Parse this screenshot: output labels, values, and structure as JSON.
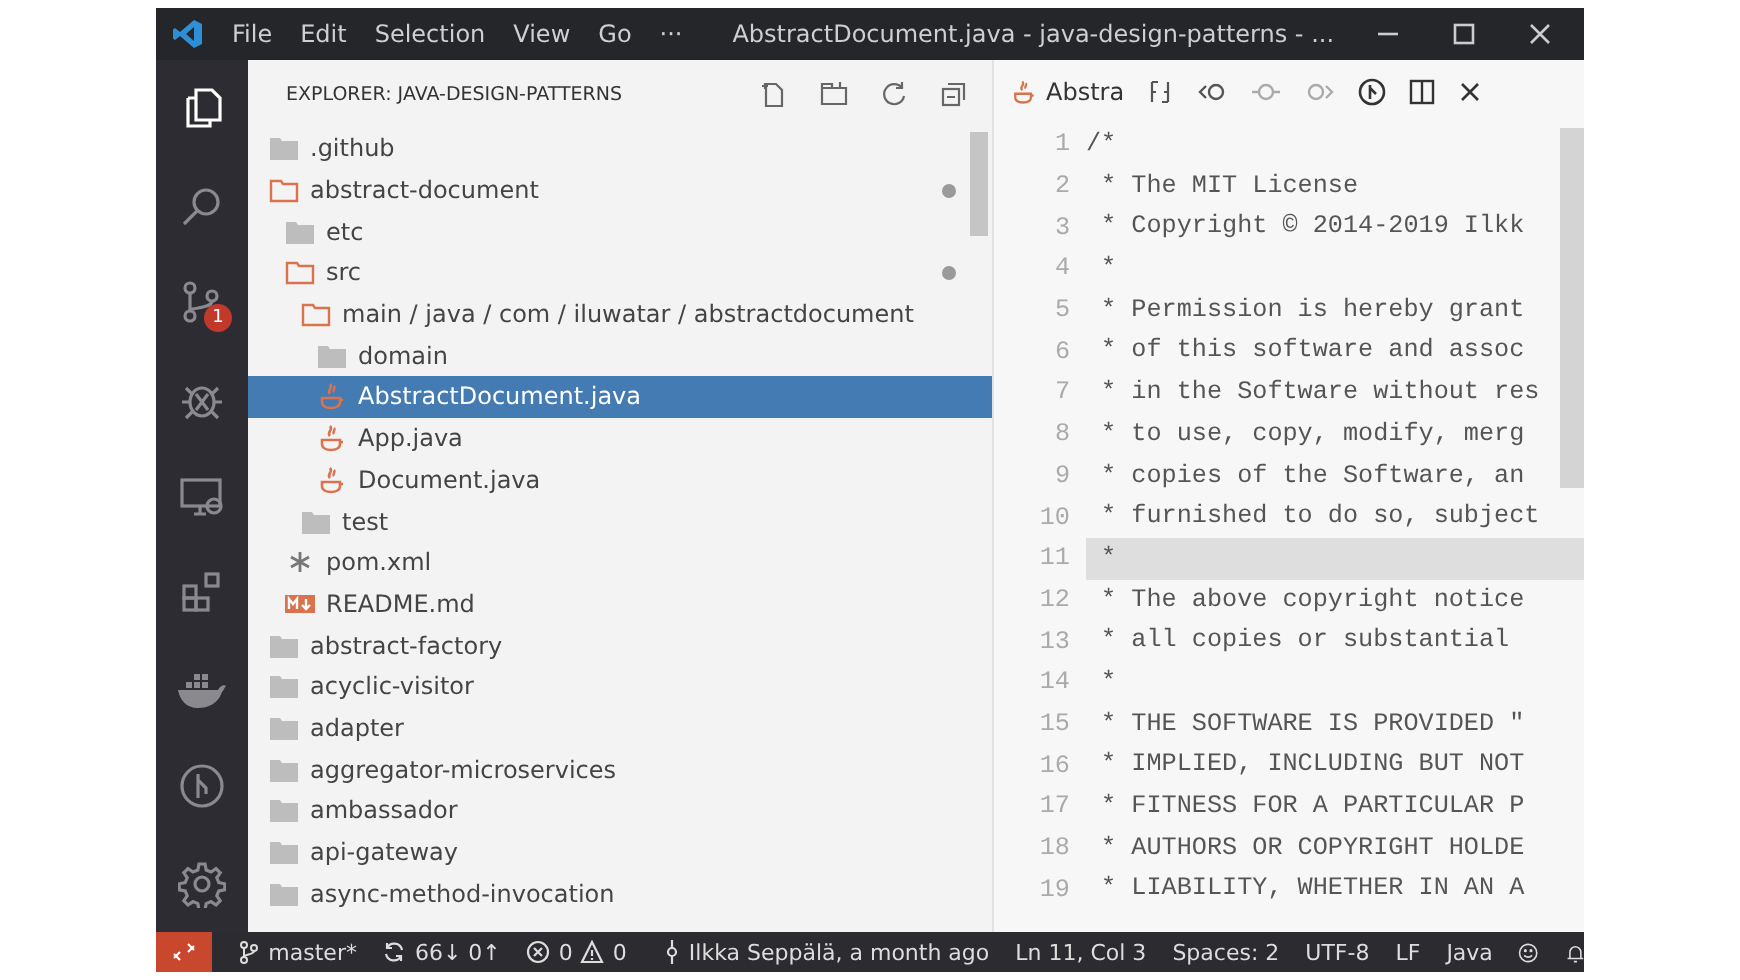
{
  "window": {
    "title": "AbstractDocument.java - java-design-patterns - ..."
  },
  "menu": [
    "File",
    "Edit",
    "Selection",
    "View",
    "Go",
    "···"
  ],
  "activity_bar": [
    {
      "kind": "files",
      "selected": true
    },
    {
      "kind": "search",
      "selected": false
    },
    {
      "kind": "source-control",
      "selected": false,
      "badge": "1"
    },
    {
      "kind": "debug",
      "selected": false
    },
    {
      "kind": "remote",
      "selected": false
    },
    {
      "kind": "extensions",
      "selected": false
    },
    {
      "kind": "docker",
      "selected": false
    },
    {
      "kind": "git-graph",
      "selected": false
    },
    {
      "kind": "settings",
      "selected": false
    }
  ],
  "explorer": {
    "title": "EXPLORER: JAVA-DESIGN-PATTERNS",
    "tree": [
      {
        "label": ".github",
        "kind": "folder",
        "expanded": false,
        "modified": false,
        "selected": false
      },
      {
        "label": "abstract-document",
        "kind": "folder",
        "expanded": true,
        "modified": true,
        "selected": false,
        "children": [
          {
            "label": "etc",
            "kind": "folder",
            "expanded": false,
            "modified": false,
            "selected": false
          },
          {
            "label": "src",
            "kind": "folder",
            "expanded": true,
            "modified": true,
            "selected": false,
            "children": [
              {
                "label": "main / java / com / iluwatar / abstractdocument",
                "kind": "folder",
                "expanded": true,
                "modified": false,
                "selected": false,
                "children": [
                  {
                    "label": "domain",
                    "kind": "folder",
                    "expanded": false,
                    "modified": false,
                    "selected": false
                  },
                  {
                    "label": "AbstractDocument.java",
                    "kind": "java",
                    "modified": false,
                    "selected": true
                  },
                  {
                    "label": "App.java",
                    "kind": "java",
                    "modified": false,
                    "selected": false
                  },
                  {
                    "label": "Document.java",
                    "kind": "java",
                    "modified": false,
                    "selected": false
                  }
                ]
              },
              {
                "label": "test",
                "kind": "folder",
                "expanded": false,
                "modified": false,
                "selected": false
              }
            ]
          },
          {
            "label": "pom.xml",
            "kind": "xml",
            "modified": false,
            "selected": false
          },
          {
            "label": "README.md",
            "kind": "markdown",
            "modified": false,
            "selected": false
          }
        ]
      },
      {
        "label": "abstract-factory",
        "kind": "folder",
        "expanded": false,
        "modified": false,
        "selected": false
      },
      {
        "label": "acyclic-visitor",
        "kind": "folder",
        "expanded": false,
        "modified": false,
        "selected": false
      },
      {
        "label": "adapter",
        "kind": "folder",
        "expanded": false,
        "modified": false,
        "selected": false
      },
      {
        "label": "aggregator-microservices",
        "kind": "folder",
        "expanded": false,
        "modified": false,
        "selected": false
      },
      {
        "label": "ambassador",
        "kind": "folder",
        "expanded": false,
        "modified": false,
        "selected": false
      },
      {
        "label": "api-gateway",
        "kind": "folder",
        "expanded": false,
        "modified": false,
        "selected": false
      },
      {
        "label": "async-method-invocation",
        "kind": "folder",
        "expanded": false,
        "modified": false,
        "selected": false
      }
    ]
  },
  "editor": {
    "tab": "Abstra",
    "lines": [
      {
        "number": "1",
        "text": "/*",
        "current": false
      },
      {
        "number": "2",
        "text": " * The MIT License",
        "current": false
      },
      {
        "number": "3",
        "text": " * Copyright © 2014-2019 Ilkk",
        "current": false
      },
      {
        "number": "4",
        "text": " *",
        "current": false
      },
      {
        "number": "5",
        "text": " * Permission is hereby grant",
        "current": false
      },
      {
        "number": "6",
        "text": " * of this software and assoc",
        "current": false
      },
      {
        "number": "7",
        "text": " * in the Software without res",
        "current": false
      },
      {
        "number": "8",
        "text": " * to use, copy, modify, merg",
        "current": false
      },
      {
        "number": "9",
        "text": " * copies of the Software, an",
        "current": false
      },
      {
        "number": "10",
        "text": " * furnished to do so, subject",
        "current": false
      },
      {
        "number": "11",
        "text": " *",
        "current": true
      },
      {
        "number": "12",
        "text": " * The above copyright notice",
        "current": false
      },
      {
        "number": "13",
        "text": " * all copies or substantial",
        "current": false
      },
      {
        "number": "14",
        "text": " *",
        "current": false
      },
      {
        "number": "15",
        "text": " * THE SOFTWARE IS PROVIDED \"",
        "current": false
      },
      {
        "number": "16",
        "text": " * IMPLIED, INCLUDING BUT NOT",
        "current": false
      },
      {
        "number": "17",
        "text": " * FITNESS FOR A PARTICULAR P",
        "current": false
      },
      {
        "number": "18",
        "text": " * AUTHORS OR COPYRIGHT HOLDE",
        "current": false
      },
      {
        "number": "19",
        "text": " * LIABILITY, WHETHER IN AN A",
        "current": false
      }
    ]
  },
  "status_bar": {
    "branch": "master*",
    "sync": "66↓ 0↑",
    "errors": "0",
    "warnings": "0",
    "blame": "Ilkka Seppälä, a month ago",
    "position": "Ln 11, Col 3",
    "indentation": "Spaces: 2",
    "encoding": "UTF-8",
    "eol": "LF",
    "language": "Java"
  }
}
